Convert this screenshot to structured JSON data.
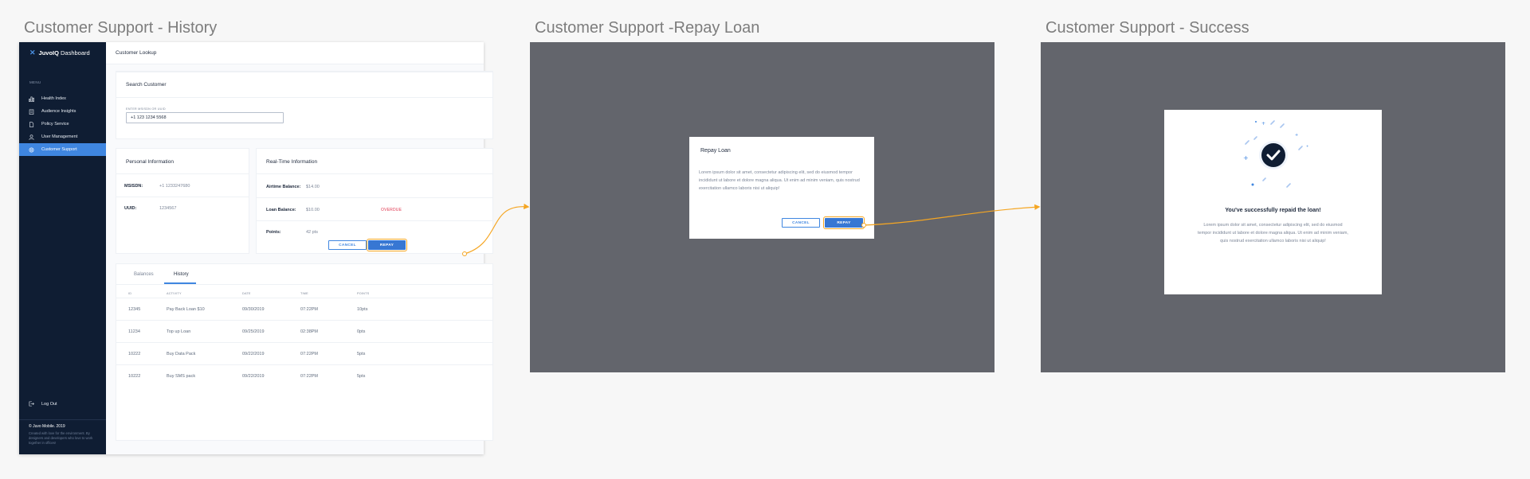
{
  "boards": {
    "history_title": "Customer Support - History",
    "repay_title": "Customer Support -Repay Loan",
    "success_title": "Customer Support - Success"
  },
  "sidebar": {
    "logo_brand": "JuvoIQ",
    "logo_suffix": "Dashboard",
    "menu_caption": "MENU",
    "items": [
      {
        "label": "Health Index",
        "icon": "bar-chart-icon"
      },
      {
        "label": "Audience Insights",
        "icon": "clipboard-icon"
      },
      {
        "label": "Policy Service",
        "icon": "document-icon"
      },
      {
        "label": "User Management",
        "icon": "user-icon"
      },
      {
        "label": "Customer Support",
        "icon": "support-icon",
        "active": true
      }
    ],
    "logout": "Log Out",
    "copyright": "© Juvo Mobile. 2019",
    "credit": "Created with love for the environment. By designers and developers who love to work together in offices!"
  },
  "header": {
    "title": "Customer Lookup"
  },
  "search": {
    "title": "Search Customer",
    "caption": "ENTER MSISDN OR UUID",
    "value": "+1 123 1234 5568"
  },
  "personal": {
    "title": "Personal Information",
    "msisdn_label": "MSISDN:",
    "msisdn_value": "+1 1233247680",
    "uuid_label": "UUID:",
    "uuid_value": "1234567"
  },
  "realtime": {
    "title": "Real-Time Information",
    "airtime_label": "Airtime Balance:",
    "airtime_value": "$14.00",
    "loan_label": "Loan Balance:",
    "loan_value": "$10.00",
    "loan_status": "OVERDUE",
    "points_label": "Points:",
    "points_value": "42 pts",
    "cancel_label": "CANCEL",
    "repay_label": "REPAY"
  },
  "history": {
    "tabs": [
      "Balances",
      "History"
    ],
    "active_tab": 1,
    "columns": [
      "ID",
      "ACTIVITY",
      "DATE",
      "TIME",
      "POINTS"
    ],
    "rows": [
      [
        "12345",
        "Pay Back Loan $10",
        "09/30/2019",
        "07:22PM",
        "10pts"
      ],
      [
        "11234",
        "Top up Loan",
        "09/25/2019",
        "02:38PM",
        "0pts"
      ],
      [
        "10222",
        "Buy Data Pack",
        "09/22/2019",
        "07:22PM",
        "5pts"
      ],
      [
        "10222",
        "Buy SMS pack",
        "09/22/2019",
        "07:22PM",
        "5pts"
      ]
    ]
  },
  "repay_modal": {
    "title": "Repay Loan",
    "body": "Lorem ipsum dolor sit amet, consectetur adipiscing elit, sed do eiusmod tempor incididunt ut labore et dolore magna aliqua. Ut enim ad minim veniam, quis nostrud exercitation ullamco laboris nisi ut aliquip!",
    "cancel_label": "CANCEL",
    "repay_label": "REPAY"
  },
  "success_modal": {
    "title": "You've successfully repaid the loan!",
    "body": "Lorem ipsum dolor sit amet, consectetur adipiscing elit, sed do eiusmod tempor incididunt ut labore et dolore magna aliqua. Ut enim ad minim veniam, quis nostrud exercitation ullamco laboris nisi ut aliquip!"
  },
  "colors": {
    "sidebar_bg": "#0f1d33",
    "accent": "#3f86e0",
    "overlay": "#63656c",
    "flow_arrow": "#f5a623",
    "overdue": "#e0354e"
  }
}
